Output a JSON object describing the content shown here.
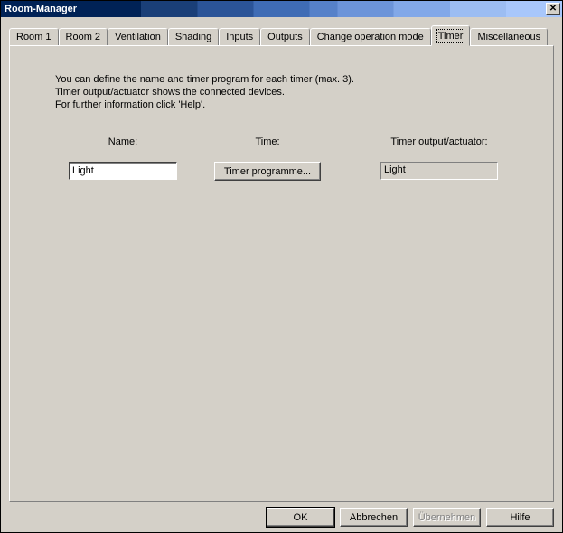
{
  "window": {
    "title": "Room-Manager"
  },
  "tabs": [
    {
      "label": "Room 1"
    },
    {
      "label": "Room 2"
    },
    {
      "label": "Ventilation"
    },
    {
      "label": "Shading"
    },
    {
      "label": "Inputs"
    },
    {
      "label": "Outputs"
    },
    {
      "label": "Change operation mode"
    },
    {
      "label": "Timer"
    },
    {
      "label": "Miscellaneous"
    }
  ],
  "active_tab_index": 7,
  "panel": {
    "intro_line1": "You can define the name and timer program for each timer (max. 3).",
    "intro_line2": "Timer output/actuator shows the connected devices.",
    "intro_line3": "For further information click 'Help'.",
    "columns": {
      "name_header": "Name:",
      "time_header": "Time:",
      "output_header": "Timer output/actuator:"
    },
    "row1": {
      "name_value": "Light",
      "time_button": "Timer programme...",
      "output_value": "Light"
    }
  },
  "buttons": {
    "ok": "OK",
    "cancel": "Abbrechen",
    "apply": "Übernehmen",
    "help": "Hilfe"
  }
}
